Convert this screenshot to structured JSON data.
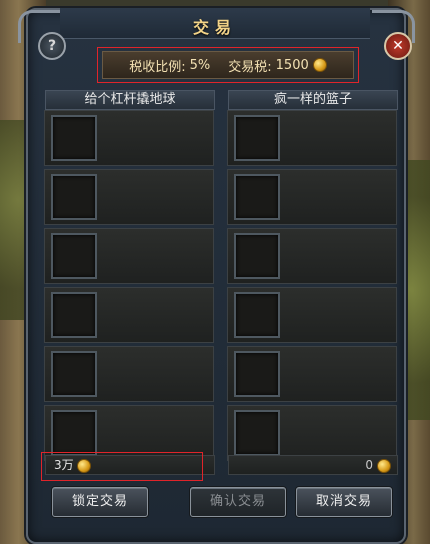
{
  "window": {
    "title": "交易",
    "help_symbol": "?",
    "close_symbol": "✕"
  },
  "tax": {
    "rate_label": "税收比例:",
    "rate_value": "5%",
    "tax_label": "交易税:",
    "tax_value": "1500",
    "currency_icon": "gold-coin-icon"
  },
  "left_party": {
    "name": "给个杠杆撬地球",
    "money": "3万",
    "slot_count": 6
  },
  "right_party": {
    "name": "疯一样的篮子",
    "money": "0",
    "slot_count": 6
  },
  "buttons": {
    "lock": "锁定交易",
    "confirm": "确认交易",
    "cancel": "取消交易"
  },
  "colors": {
    "highlight": "#e0242a",
    "title": "#f3d488",
    "coin": "#d79a18"
  }
}
